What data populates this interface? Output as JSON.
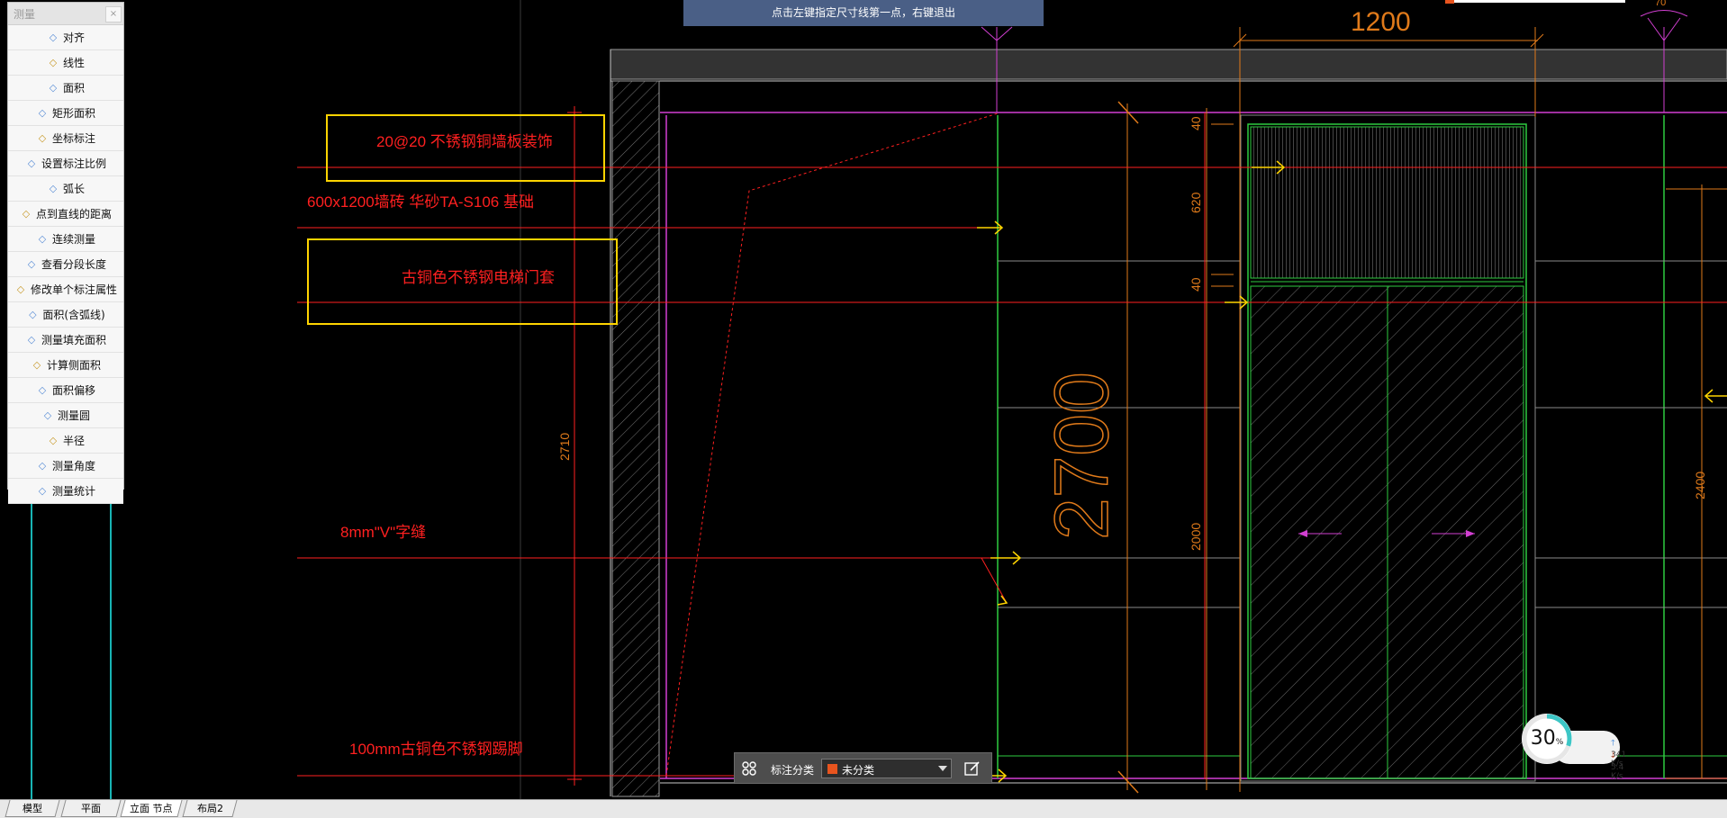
{
  "status_tip": "点击左键指定尺寸线第一点，右键退出",
  "measure_panel": {
    "title": "测量",
    "close_glyph": "×",
    "tools": [
      {
        "label": "对齐",
        "icon": "align-dimension-icon"
      },
      {
        "label": "线性",
        "icon": "linear-dimension-icon"
      },
      {
        "label": "面积",
        "icon": "area-icon"
      },
      {
        "label": "矩形面积",
        "icon": "rectangle-area-icon"
      },
      {
        "label": "坐标标注",
        "icon": "coordinate-icon"
      },
      {
        "label": "设置标注比例",
        "icon": "scale-icon"
      },
      {
        "label": "弧长",
        "icon": "arc-length-icon"
      },
      {
        "label": "点到直线的距离",
        "icon": "point-line-distance-icon"
      },
      {
        "label": "连续测量",
        "icon": "continuous-measure-icon"
      },
      {
        "label": "查看分段长度",
        "icon": "segment-length-icon"
      },
      {
        "label": "修改单个标注属性",
        "icon": "edit-dimension-icon"
      },
      {
        "label": "面积(含弧线)",
        "icon": "arc-area-icon"
      },
      {
        "label": "测量填充面积",
        "icon": "hatch-area-icon"
      },
      {
        "label": "计算侧面积",
        "icon": "side-area-icon"
      },
      {
        "label": "面积偏移",
        "icon": "area-offset-icon"
      },
      {
        "label": "测量圆",
        "icon": "circle-icon"
      },
      {
        "label": "半径",
        "icon": "radius-icon"
      },
      {
        "label": "测量角度",
        "icon": "angle-icon"
      },
      {
        "label": "测量统计",
        "icon": "statistics-icon"
      }
    ]
  },
  "drawing": {
    "annotations": [
      "20@20 不锈钢铜墙板装饰",
      "600x1200墙砖 华砂TA-S106 基础",
      "古铜色不锈钢电梯门套",
      "8mm\"V\"字缝",
      "100mm古铜色不锈钢踢脚"
    ],
    "dimensions": {
      "top_width": "1200",
      "angle_top_right": "70",
      "big_height": "2700",
      "left_height": "2710",
      "seg_top": "40",
      "seg_620": "620",
      "seg_40b": "40",
      "seg_2000": "2000",
      "right_height": "2400"
    }
  },
  "annotation_toolbar": {
    "label": "标注分类",
    "selected": "未分类",
    "swatch_color": "#e8541e"
  },
  "network_widget": {
    "percent": "30",
    "percent_unit": "%",
    "upload": "341 K/s",
    "download": "5.4 K/s"
  },
  "tabs": [
    {
      "label": "模型",
      "active": false
    },
    {
      "label": "平面",
      "active": false
    },
    {
      "label": "立面 节点",
      "active": true
    },
    {
      "label": "布局2",
      "active": false
    }
  ],
  "colors": {
    "red": "#ff2020",
    "orange": "#e07a1a",
    "yellow": "#ffd400",
    "green": "#2ecc40",
    "magenta": "#d23fd2",
    "cyan": "#18b4b4",
    "gray": "#8a8a8a"
  }
}
